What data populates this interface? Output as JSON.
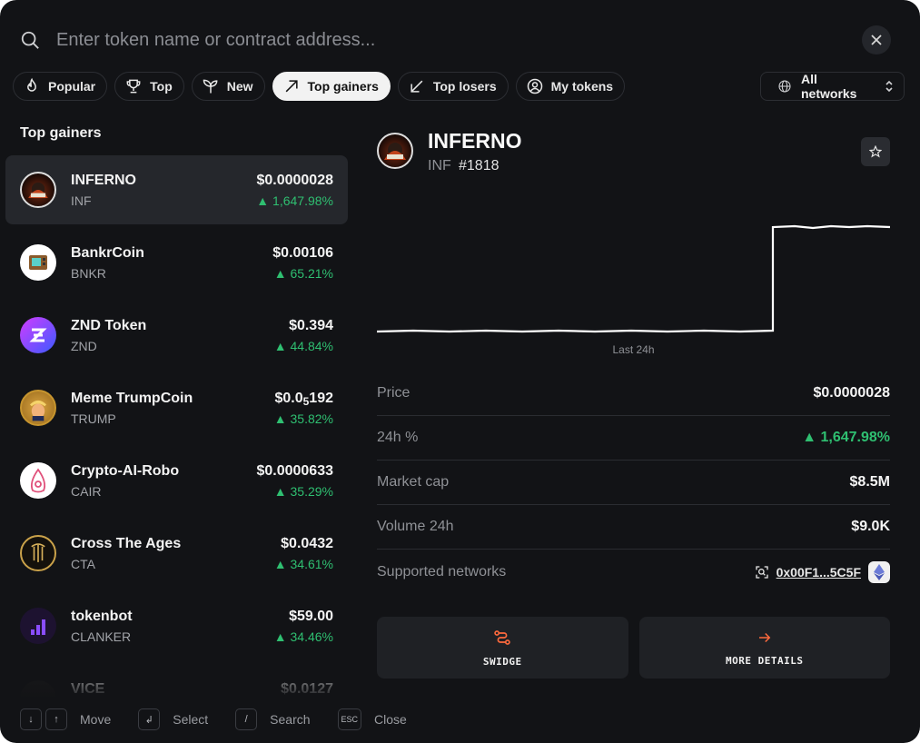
{
  "search": {
    "placeholder": "Enter token name or contract address..."
  },
  "tabs": [
    {
      "label": "Popular",
      "icon": "flame-icon"
    },
    {
      "label": "Top",
      "icon": "trophy-icon"
    },
    {
      "label": "New",
      "icon": "sprout-icon"
    },
    {
      "label": "Top gainers",
      "icon": "trend-up-icon",
      "active": true
    },
    {
      "label": "Top losers",
      "icon": "trend-down-icon"
    },
    {
      "label": "My tokens",
      "icon": "user-icon"
    }
  ],
  "networks": {
    "label": "All networks",
    "icon": "globe-icon"
  },
  "list": {
    "title": "Top gainers",
    "tokens": [
      {
        "name": "INFERNO",
        "symbol": "INF",
        "price": "$0.0000028",
        "change": "▲ 1,647.98%"
      },
      {
        "name": "BankrCoin",
        "symbol": "BNKR",
        "price": "$0.00106",
        "change": "▲ 65.21%"
      },
      {
        "name": "ZND Token",
        "symbol": "ZND",
        "price": "$0.394",
        "change": "▲ 44.84%"
      },
      {
        "name": "Meme TrumpCoin",
        "symbol": "TRUMP",
        "price_main": "$0.0",
        "price_sub": "5",
        "price_tail": "192",
        "change": "▲ 35.82%"
      },
      {
        "name": "Crypto-AI-Robo",
        "symbol": "CAIR",
        "price": "$0.0000633",
        "change": "▲ 35.29%"
      },
      {
        "name": "Cross The Ages",
        "symbol": "CTA",
        "price": "$0.0432",
        "change": "▲ 34.61%"
      },
      {
        "name": "tokenbot",
        "symbol": "CLANKER",
        "price": "$59.00",
        "change": "▲ 34.46%"
      },
      {
        "name": "VICE",
        "symbol": "",
        "price": "$0.0127",
        "change": ""
      }
    ]
  },
  "detail": {
    "name": "INFERNO",
    "symbol": "INF",
    "rank": "#1818",
    "chart_label": "Last 24h",
    "stats": {
      "price_label": "Price",
      "price": "$0.0000028",
      "change_label": "24h %",
      "change": "▲  1,647.98%",
      "mcap_label": "Market cap",
      "mcap": "$8.5M",
      "volume_label": "Volume 24h",
      "volume": "$9.0K",
      "networks_label": "Supported networks",
      "address": "0x00F1...5C5F"
    },
    "actions": {
      "swidge": "SWIDGE",
      "more": "MORE DETAILS"
    }
  },
  "footer": {
    "move": "Move",
    "select": "Select",
    "search": "Search",
    "close": "Close",
    "esc": "ESC",
    "slash": "/",
    "enter": "↲",
    "down": "↓",
    "up": "↑"
  },
  "colors": {
    "background": "#121316",
    "accent_green": "#2fbf71",
    "accent_orange": "#ff6a3d"
  }
}
